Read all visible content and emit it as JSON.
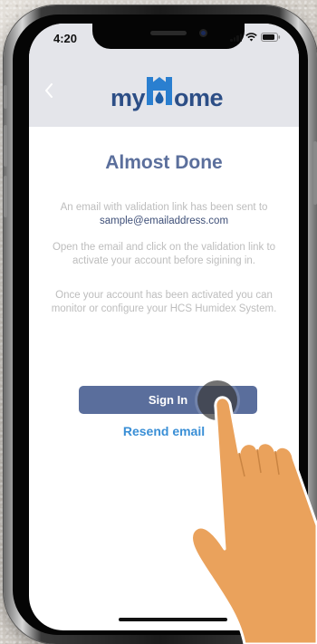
{
  "status_bar": {
    "time": "4:20"
  },
  "header": {
    "logo_prefix": "my",
    "logo_suffix": "ome",
    "logo_letter": "H"
  },
  "main": {
    "title": "Almost Done",
    "message_line1": "An email with validation link has been sent to",
    "email": "sample@emailaddress.com",
    "instructions": "Open the email and click on the validation link to activate your account before sigining in.",
    "activation_note": "Once your account has been activated you can monitor or configure your HCS Humidex System.",
    "signin_label": "Sign In",
    "resend_label": "Resend email"
  },
  "colors": {
    "accent": "#5a6e9c",
    "link": "#3a8fd6",
    "logo": "#2c4e86",
    "header_bg": "#e4e5ea",
    "muted_text": "#bdbdbd"
  }
}
